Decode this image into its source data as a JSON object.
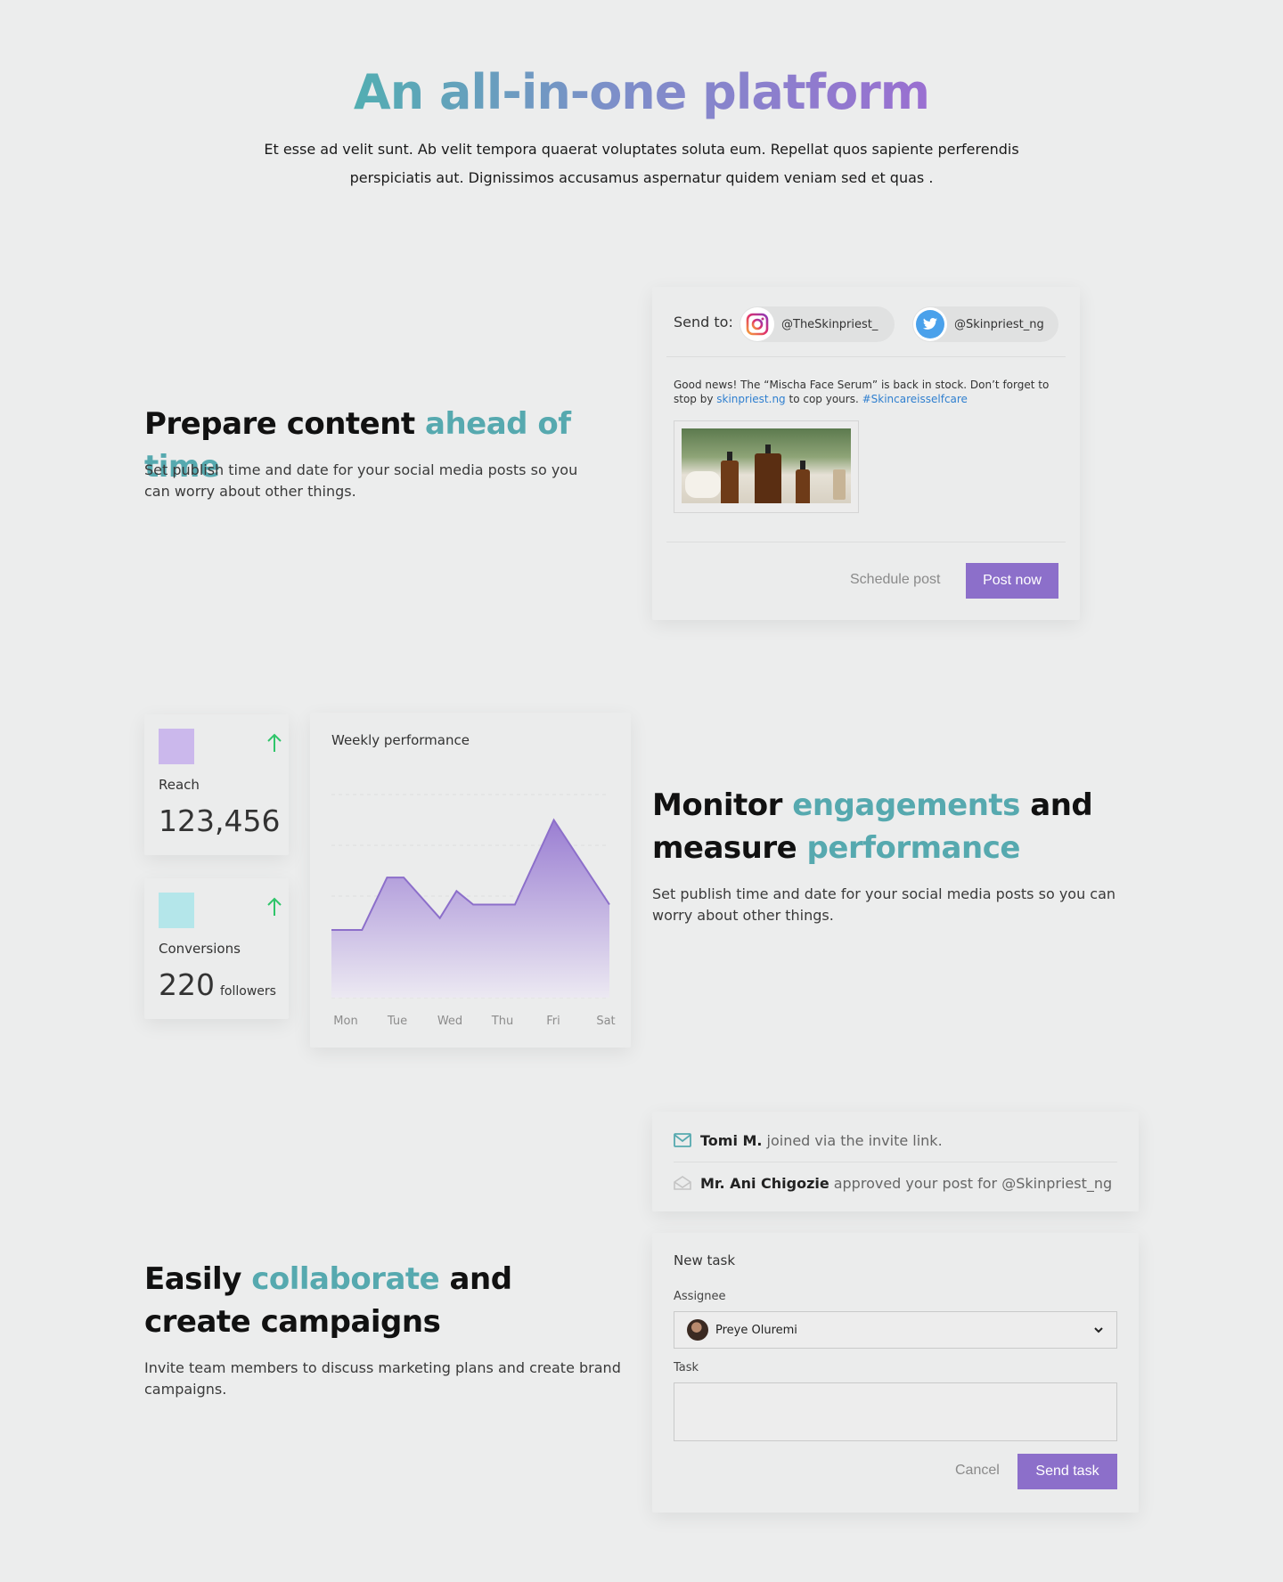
{
  "hero": {
    "title": "An all-in-one platform",
    "subtitle": "Et esse ad velit sunt. Ab velit tempora quaerat voluptates soluta eum. Repellat quos sapiente perferendis perspiciatis aut. Dignissimos accusamus aspernatur quidem veniam sed et quas ."
  },
  "prepare": {
    "title_plain": "Prepare content ",
    "title_accent": "ahead of time",
    "description": "Set publish time and date for your social media posts so you can worry about other things."
  },
  "compose": {
    "send_to_label": "Send to:",
    "accounts": [
      {
        "handle": "@TheSkinpriest_",
        "icon": "instagram-icon"
      },
      {
        "handle": "@Skinpriest_ng",
        "icon": "twitter-icon"
      }
    ],
    "post": {
      "text_before": "Good news! The “Mischa Face Serum” is back in stock. Don’t forget to stop by ",
      "link": "skinpriest.ng",
      "text_middle": " to cop yours. ",
      "hashtag": "#Skincareisselfcare"
    },
    "schedule_label": "Schedule post",
    "post_now_label": "Post now"
  },
  "stats": [
    {
      "name": "Reach",
      "value": "123,456",
      "unit": "",
      "color": "#cbb8ec",
      "trend": "up"
    },
    {
      "name": "Conversions",
      "value": "220",
      "unit": "followers",
      "color": "#b4e6ea",
      "trend": "up"
    }
  ],
  "chart_data": {
    "type": "area",
    "title": "Weekly performance",
    "categories": [
      "Mon",
      "Tue",
      "Wed",
      "Thu",
      "Fri",
      "Sat"
    ],
    "grid": true,
    "colors": {
      "line": "#8c6fca",
      "fill_top": "#9a7ed2",
      "fill_bottom": "#ece9f2"
    },
    "series": [
      {
        "x": [
          0,
          0.55,
          1.0,
          1.3,
          1.95,
          2.25,
          2.55,
          3.3,
          4.0,
          5.0
        ],
        "y": [
          40,
          40,
          71,
          71,
          47,
          63,
          55,
          55,
          105,
          55
        ]
      }
    ],
    "ylim": [
      0,
      120
    ]
  },
  "monitor": {
    "line1_plain": "Monitor ",
    "line1_accent": "engagements",
    "line1_end": " and",
    "line2_plain": "measure ",
    "line2_accent": "performance",
    "description": "Set publish time and date for your social media posts so you can worry about other things."
  },
  "collaborate": {
    "title_plain": "Easily ",
    "title_accent": "collaborate",
    "title_end": " and create campaigns",
    "description": "Invite team members to discuss marketing plans and create brand campaigns."
  },
  "notifications": [
    {
      "name": "Tomi M.",
      "text": "joined via the invite link.",
      "icon": "envelope-icon",
      "color": "#56a9af"
    },
    {
      "name": "Mr. Ani Chigozie",
      "text": "approved your post for @Skinpriest_ng",
      "icon": "envelope-open-icon",
      "color": "#c4c4c4"
    }
  ],
  "task": {
    "title": "New task",
    "assignee_label": "Assignee",
    "assignee_value": "Preye Oluremi",
    "task_label": "Task",
    "task_value": "",
    "cancel_label": "Cancel",
    "send_label": "Send task"
  }
}
